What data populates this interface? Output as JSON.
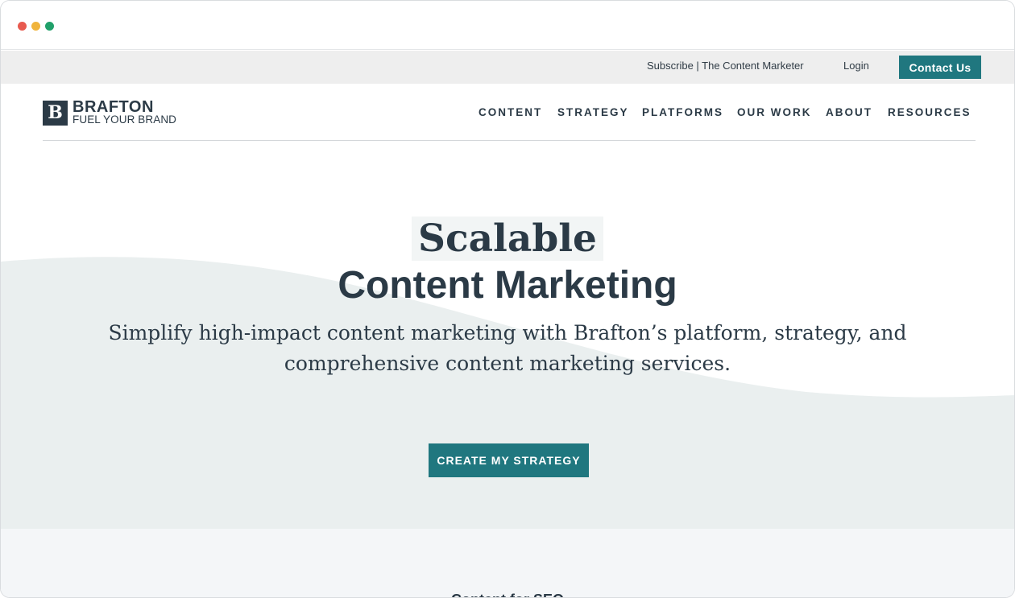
{
  "colors": {
    "brand_teal": "#20777f",
    "text_dark": "#2b3a46",
    "wave_fill": "#eaefef",
    "dot_red": "#e85a4f",
    "dot_yellow": "#f0b43c",
    "dot_green": "#21a06a"
  },
  "utility_bar": {
    "subscribe_label": "Subscribe | The Content Marketer",
    "login_label": "Login",
    "contact_label": "Contact Us"
  },
  "logo": {
    "mark": "B",
    "name": "BRAFTON",
    "tagline": "FUEL YOUR BRAND"
  },
  "nav": {
    "items": [
      "CONTENT",
      "STRATEGY",
      "PLATFORMS",
      "OUR WORK",
      "ABOUT",
      "RESOURCES"
    ]
  },
  "hero": {
    "title_line1": "Scalable",
    "title_line2": "Content Marketing",
    "subtitle": "Simplify high-impact content marketing with Brafton’s platform, strategy, and comprehensive content marketing services.",
    "cta_label": "CREATE MY STRATEGY"
  },
  "next_section": {
    "peek_text": "Content for SEO"
  }
}
